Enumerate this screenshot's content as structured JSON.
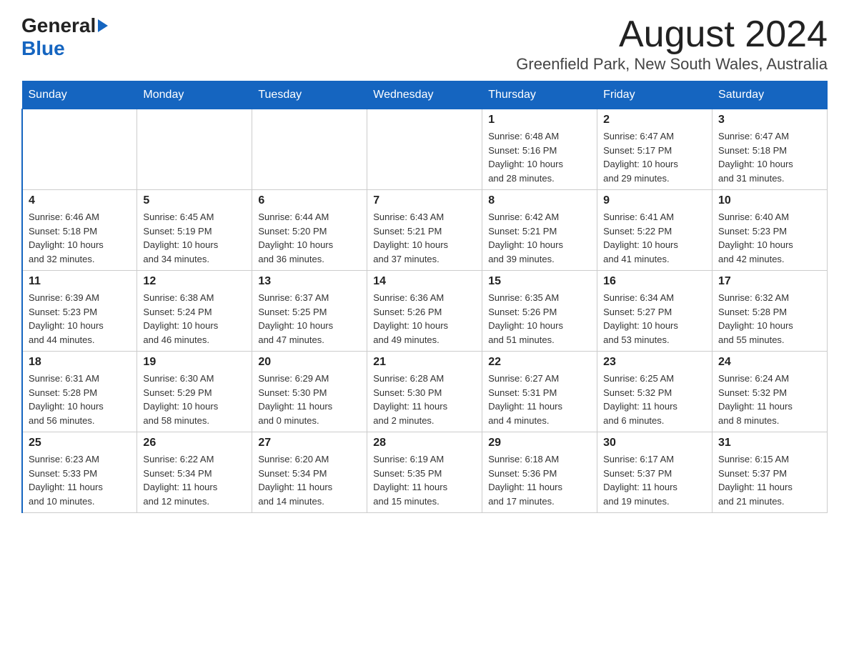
{
  "logo": {
    "general": "General",
    "blue": "Blue"
  },
  "title": "August 2024",
  "location": "Greenfield Park, New South Wales, Australia",
  "headers": [
    "Sunday",
    "Monday",
    "Tuesday",
    "Wednesday",
    "Thursday",
    "Friday",
    "Saturday"
  ],
  "weeks": [
    [
      {
        "day": "",
        "info": ""
      },
      {
        "day": "",
        "info": ""
      },
      {
        "day": "",
        "info": ""
      },
      {
        "day": "",
        "info": ""
      },
      {
        "day": "1",
        "info": "Sunrise: 6:48 AM\nSunset: 5:16 PM\nDaylight: 10 hours\nand 28 minutes."
      },
      {
        "day": "2",
        "info": "Sunrise: 6:47 AM\nSunset: 5:17 PM\nDaylight: 10 hours\nand 29 minutes."
      },
      {
        "day": "3",
        "info": "Sunrise: 6:47 AM\nSunset: 5:18 PM\nDaylight: 10 hours\nand 31 minutes."
      }
    ],
    [
      {
        "day": "4",
        "info": "Sunrise: 6:46 AM\nSunset: 5:18 PM\nDaylight: 10 hours\nand 32 minutes."
      },
      {
        "day": "5",
        "info": "Sunrise: 6:45 AM\nSunset: 5:19 PM\nDaylight: 10 hours\nand 34 minutes."
      },
      {
        "day": "6",
        "info": "Sunrise: 6:44 AM\nSunset: 5:20 PM\nDaylight: 10 hours\nand 36 minutes."
      },
      {
        "day": "7",
        "info": "Sunrise: 6:43 AM\nSunset: 5:21 PM\nDaylight: 10 hours\nand 37 minutes."
      },
      {
        "day": "8",
        "info": "Sunrise: 6:42 AM\nSunset: 5:21 PM\nDaylight: 10 hours\nand 39 minutes."
      },
      {
        "day": "9",
        "info": "Sunrise: 6:41 AM\nSunset: 5:22 PM\nDaylight: 10 hours\nand 41 minutes."
      },
      {
        "day": "10",
        "info": "Sunrise: 6:40 AM\nSunset: 5:23 PM\nDaylight: 10 hours\nand 42 minutes."
      }
    ],
    [
      {
        "day": "11",
        "info": "Sunrise: 6:39 AM\nSunset: 5:23 PM\nDaylight: 10 hours\nand 44 minutes."
      },
      {
        "day": "12",
        "info": "Sunrise: 6:38 AM\nSunset: 5:24 PM\nDaylight: 10 hours\nand 46 minutes."
      },
      {
        "day": "13",
        "info": "Sunrise: 6:37 AM\nSunset: 5:25 PM\nDaylight: 10 hours\nand 47 minutes."
      },
      {
        "day": "14",
        "info": "Sunrise: 6:36 AM\nSunset: 5:26 PM\nDaylight: 10 hours\nand 49 minutes."
      },
      {
        "day": "15",
        "info": "Sunrise: 6:35 AM\nSunset: 5:26 PM\nDaylight: 10 hours\nand 51 minutes."
      },
      {
        "day": "16",
        "info": "Sunrise: 6:34 AM\nSunset: 5:27 PM\nDaylight: 10 hours\nand 53 minutes."
      },
      {
        "day": "17",
        "info": "Sunrise: 6:32 AM\nSunset: 5:28 PM\nDaylight: 10 hours\nand 55 minutes."
      }
    ],
    [
      {
        "day": "18",
        "info": "Sunrise: 6:31 AM\nSunset: 5:28 PM\nDaylight: 10 hours\nand 56 minutes."
      },
      {
        "day": "19",
        "info": "Sunrise: 6:30 AM\nSunset: 5:29 PM\nDaylight: 10 hours\nand 58 minutes."
      },
      {
        "day": "20",
        "info": "Sunrise: 6:29 AM\nSunset: 5:30 PM\nDaylight: 11 hours\nand 0 minutes."
      },
      {
        "day": "21",
        "info": "Sunrise: 6:28 AM\nSunset: 5:30 PM\nDaylight: 11 hours\nand 2 minutes."
      },
      {
        "day": "22",
        "info": "Sunrise: 6:27 AM\nSunset: 5:31 PM\nDaylight: 11 hours\nand 4 minutes."
      },
      {
        "day": "23",
        "info": "Sunrise: 6:25 AM\nSunset: 5:32 PM\nDaylight: 11 hours\nand 6 minutes."
      },
      {
        "day": "24",
        "info": "Sunrise: 6:24 AM\nSunset: 5:32 PM\nDaylight: 11 hours\nand 8 minutes."
      }
    ],
    [
      {
        "day": "25",
        "info": "Sunrise: 6:23 AM\nSunset: 5:33 PM\nDaylight: 11 hours\nand 10 minutes."
      },
      {
        "day": "26",
        "info": "Sunrise: 6:22 AM\nSunset: 5:34 PM\nDaylight: 11 hours\nand 12 minutes."
      },
      {
        "day": "27",
        "info": "Sunrise: 6:20 AM\nSunset: 5:34 PM\nDaylight: 11 hours\nand 14 minutes."
      },
      {
        "day": "28",
        "info": "Sunrise: 6:19 AM\nSunset: 5:35 PM\nDaylight: 11 hours\nand 15 minutes."
      },
      {
        "day": "29",
        "info": "Sunrise: 6:18 AM\nSunset: 5:36 PM\nDaylight: 11 hours\nand 17 minutes."
      },
      {
        "day": "30",
        "info": "Sunrise: 6:17 AM\nSunset: 5:37 PM\nDaylight: 11 hours\nand 19 minutes."
      },
      {
        "day": "31",
        "info": "Sunrise: 6:15 AM\nSunset: 5:37 PM\nDaylight: 11 hours\nand 21 minutes."
      }
    ]
  ]
}
